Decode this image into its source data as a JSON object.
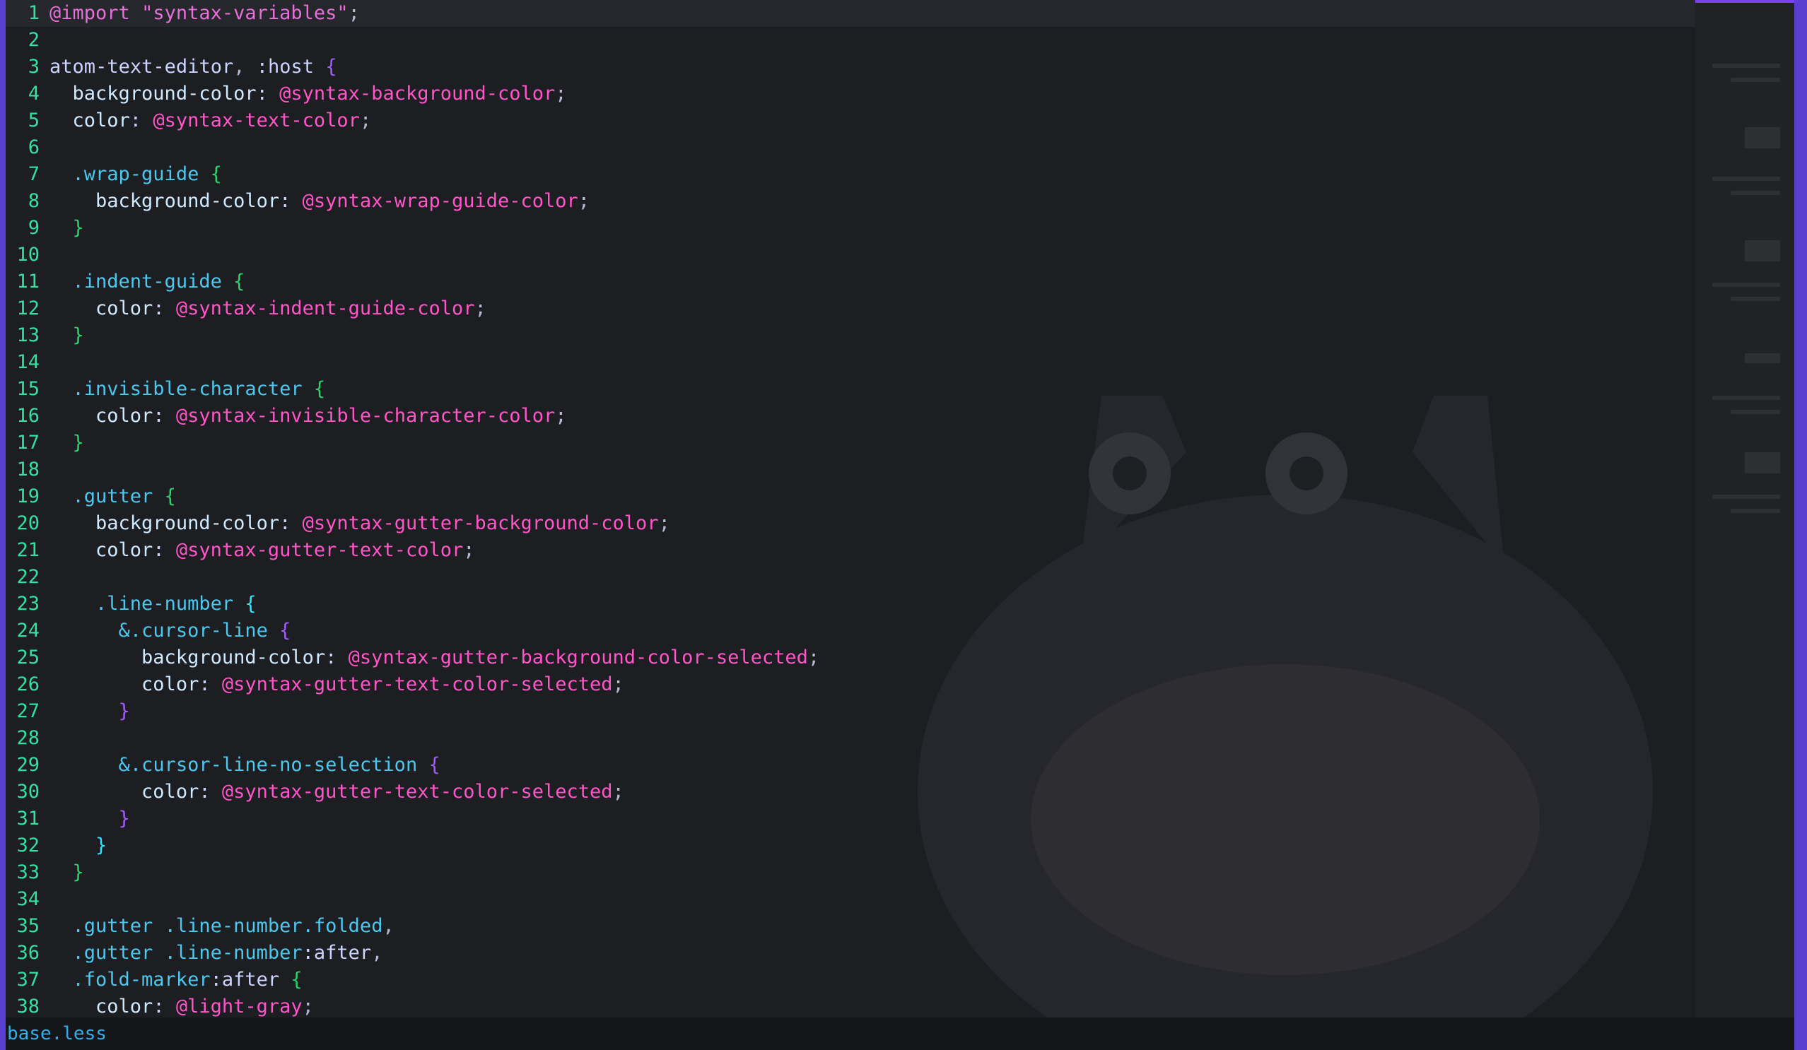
{
  "statusbar": {
    "filename": "base.less"
  },
  "editor": {
    "cursor_line": 1,
    "lines": [
      "@import \"syntax-variables\";",
      "",
      "atom-text-editor, :host {",
      "  background-color: @syntax-background-color;",
      "  color: @syntax-text-color;",
      "",
      "  .wrap-guide {",
      "    background-color: @syntax-wrap-guide-color;",
      "  }",
      "",
      "  .indent-guide {",
      "    color: @syntax-indent-guide-color;",
      "  }",
      "",
      "  .invisible-character {",
      "    color: @syntax-invisible-character-color;",
      "  }",
      "",
      "  .gutter {",
      "    background-color: @syntax-gutter-background-color;",
      "    color: @syntax-gutter-text-color;",
      "",
      "    .line-number {",
      "      &.cursor-line {",
      "        background-color: @syntax-gutter-background-color-selected;",
      "        color: @syntax-gutter-text-color-selected;",
      "      }",
      "",
      "      &.cursor-line-no-selection {",
      "        color: @syntax-gutter-text-color-selected;",
      "      }",
      "    }",
      "  }",
      "",
      "  .gutter .line-number.folded,",
      "  .gutter .line-number:after,",
      "  .fold-marker:after {",
      "    color: @light-gray;"
    ]
  },
  "colors": {
    "editor_background": "#1d1e22",
    "line_number": "#33e0a0",
    "variable": "#ff55c8",
    "selector": "#4cc7ee",
    "brace_level_1": "#a35cff",
    "brace_level_2": "#2bd46a",
    "brace_level_3": "#2ee6ff",
    "statusbar_filename": "#33aee8"
  }
}
